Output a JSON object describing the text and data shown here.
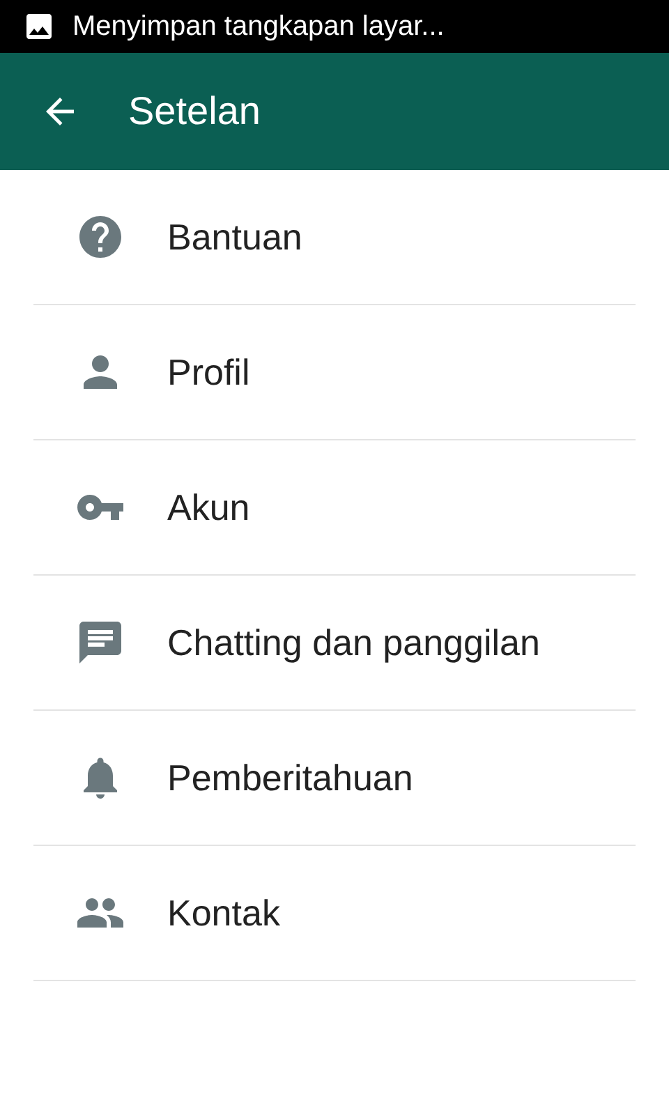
{
  "status_bar": {
    "notification": "Menyimpan tangkapan layar..."
  },
  "app_bar": {
    "title": "Setelan"
  },
  "items": [
    {
      "label": "Bantuan"
    },
    {
      "label": "Profil"
    },
    {
      "label": "Akun"
    },
    {
      "label": "Chatting dan panggilan"
    },
    {
      "label": "Pemberitahuan"
    },
    {
      "label": "Kontak"
    }
  ]
}
